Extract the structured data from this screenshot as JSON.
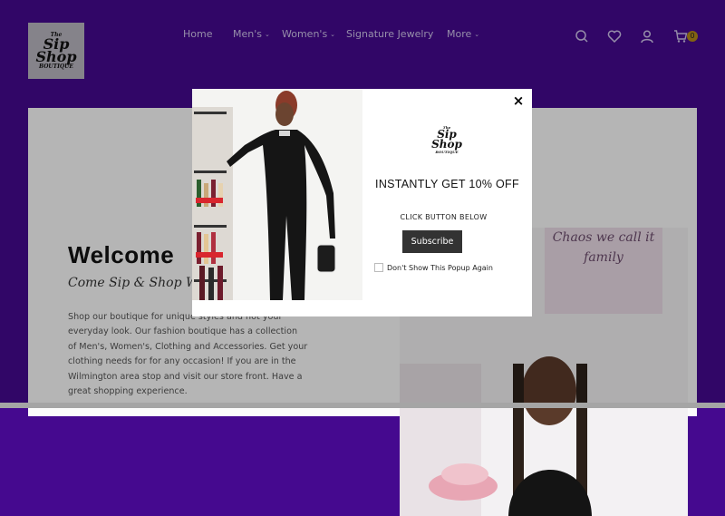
{
  "header": {
    "logo": {
      "line1": "The",
      "line2": "Sip",
      "line3": "Shop",
      "line4": "BOUTIQUE"
    },
    "nav": [
      {
        "label": "Home",
        "has_dropdown": false
      },
      {
        "label": "Men's",
        "has_dropdown": true
      },
      {
        "label": "Women's",
        "has_dropdown": true
      },
      {
        "label": "Signature Jewelry",
        "has_dropdown": false
      },
      {
        "label": "More",
        "has_dropdown": true
      }
    ],
    "icons": [
      "search-icon",
      "heart-icon",
      "user-icon",
      "cart-icon"
    ],
    "cart_count": "0"
  },
  "main": {
    "welcome": "Welcome",
    "tagline": "Come Sip & Shop With Us",
    "about": "Shop our boutique for unique styles and hot your everyday look. Our fashion boutique has a collection of Men's, Women's, Clothing and Accessories. Get your clothing needs for for any occasion! If you are in the Wilmington area stop and visit our store front. Have a great shopping experience.",
    "sign_text": "Chaos we call it family"
  },
  "popup": {
    "logo": {
      "line1": "The",
      "line2": "Sip",
      "line3": "Shop",
      "line4": "BOUTIQUE"
    },
    "offer": "INSTANTLY GET 10% OFF",
    "instruction": "CLICK BUTTON BELOW",
    "button": "Subscribe",
    "checkbox_label": "Don't Show This Popup Again",
    "close": "×"
  },
  "colors": {
    "header_bg": "#45098f",
    "nav_text": "#cfc4ea",
    "cart_badge": "#b48a18",
    "button_bg": "#333333"
  }
}
